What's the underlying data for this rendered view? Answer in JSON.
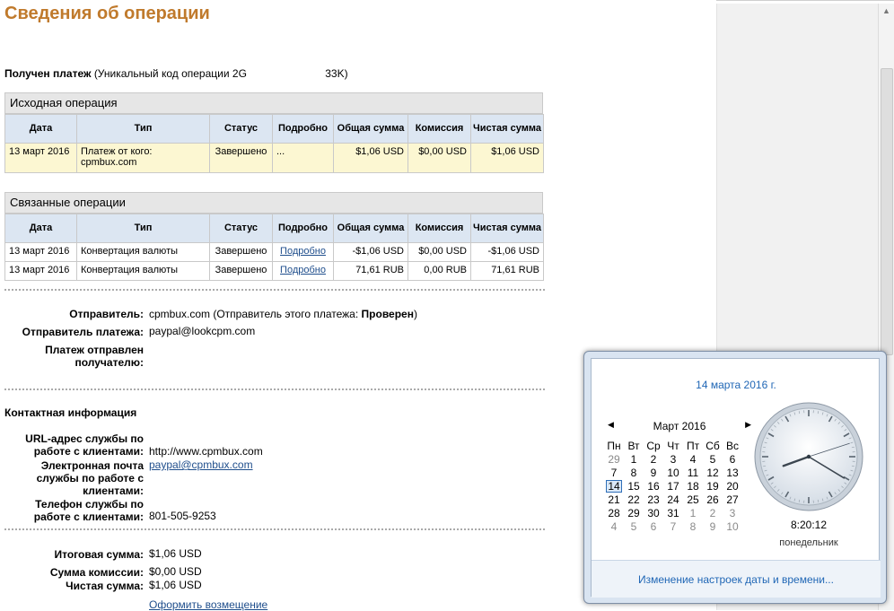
{
  "page": {
    "title": "Сведения об операции",
    "received_label": "Получен платеж",
    "received_detail": "(Уникальный код операции 2G",
    "received_code_tail": "33K)"
  },
  "original": {
    "section_title": "Исходная операция",
    "columns": [
      "Дата",
      "Тип",
      "Статус",
      "Подробно",
      "Общая сумма",
      "Комиссия",
      "Чистая сумма"
    ],
    "rows": [
      {
        "date": "13 март 2016",
        "type": "Платеж от кого: cpmbux.com",
        "status": "Завершено",
        "details": "...",
        "gross": "$1,06 USD",
        "fee": "$0,00 USD",
        "net": "$1,06 USD"
      }
    ]
  },
  "related": {
    "section_title": "Связанные операции",
    "columns": [
      "Дата",
      "Тип",
      "Статус",
      "Подробно",
      "Общая сумма",
      "Комиссия",
      "Чистая сумма"
    ],
    "rows": [
      {
        "date": "13 март 2016",
        "type": "Конвертация валюты",
        "status": "Завершено",
        "details": "Подробно",
        "gross": "-$1,06 USD",
        "fee": "$0,00 USD",
        "net": "-$1,06 USD"
      },
      {
        "date": "13 март 2016",
        "type": "Конвертация валюты",
        "status": "Завершено",
        "details": "Подробно",
        "gross": "71,61 RUB",
        "fee": "0,00 RUB",
        "net": "71,61 RUB"
      }
    ]
  },
  "sender": {
    "sender_label": "Отправитель:",
    "sender_value": "cpmbux.com (Отправитель этого платежа:",
    "sender_status": "Проверен",
    "sender_close": ")",
    "payer_label": "Отправитель платежа:",
    "payer_value": "paypal@lookcpm.com",
    "sent_to_label": "Платеж отправлен получателю:"
  },
  "contact": {
    "heading": "Контактная информация",
    "url_label": "URL-адрес службы по работе с клиентами:",
    "url_value": "http://www.cpmbux.com",
    "email_label": "Электронная почта службы по работе с клиентами:",
    "email_value": "paypal@cpmbux.com",
    "phone_label": "Телефон службы по работе с клиентами:",
    "phone_value": "801-505-9253"
  },
  "totals": {
    "total_label": "Итоговая сумма:",
    "total_value": "$1,06 USD",
    "fee_label": "Сумма комиссии:",
    "fee_value": "$0,00 USD",
    "net_label": "Чистая сумма:",
    "net_value": "$1,06 USD",
    "refund_link": "Оформить возмещение"
  },
  "calendar": {
    "full_date": "14 марта 2016 г.",
    "month_title": "Март 2016",
    "prev_icon": "triangle-left",
    "next_icon": "triangle-right",
    "weekdays": [
      "Пн",
      "Вт",
      "Ср",
      "Чт",
      "Пт",
      "Сб",
      "Вс"
    ],
    "weeks": [
      [
        {
          "d": "29",
          "o": true
        },
        {
          "d": "1"
        },
        {
          "d": "2"
        },
        {
          "d": "3"
        },
        {
          "d": "4"
        },
        {
          "d": "5"
        },
        {
          "d": "6"
        }
      ],
      [
        {
          "d": "7"
        },
        {
          "d": "8"
        },
        {
          "d": "9"
        },
        {
          "d": "10"
        },
        {
          "d": "11"
        },
        {
          "d": "12"
        },
        {
          "d": "13"
        }
      ],
      [
        {
          "d": "14",
          "t": true
        },
        {
          "d": "15"
        },
        {
          "d": "16"
        },
        {
          "d": "17"
        },
        {
          "d": "18"
        },
        {
          "d": "19"
        },
        {
          "d": "20"
        }
      ],
      [
        {
          "d": "21"
        },
        {
          "d": "22"
        },
        {
          "d": "23"
        },
        {
          "d": "24"
        },
        {
          "d": "25"
        },
        {
          "d": "26"
        },
        {
          "d": "27"
        }
      ],
      [
        {
          "d": "28"
        },
        {
          "d": "29"
        },
        {
          "d": "30"
        },
        {
          "d": "31"
        },
        {
          "d": "1",
          "o": true
        },
        {
          "d": "2",
          "o": true
        },
        {
          "d": "3",
          "o": true
        }
      ],
      [
        {
          "d": "4",
          "o": true
        },
        {
          "d": "5",
          "o": true
        },
        {
          "d": "6",
          "o": true
        },
        {
          "d": "7",
          "o": true
        },
        {
          "d": "8",
          "o": true
        },
        {
          "d": "9",
          "o": true
        },
        {
          "d": "10",
          "o": true
        }
      ]
    ],
    "time": "8:20:12",
    "weekday_name": "понедельник",
    "settings_link": "Изменение настроек даты и времени...",
    "clock": {
      "hour": 8,
      "minute": 20,
      "second": 12
    }
  },
  "colors": {
    "title": "#c07a2c",
    "link": "#1f4e8c",
    "header_bg": "#dce6f2",
    "highlight_row": "#fcf7d2"
  }
}
